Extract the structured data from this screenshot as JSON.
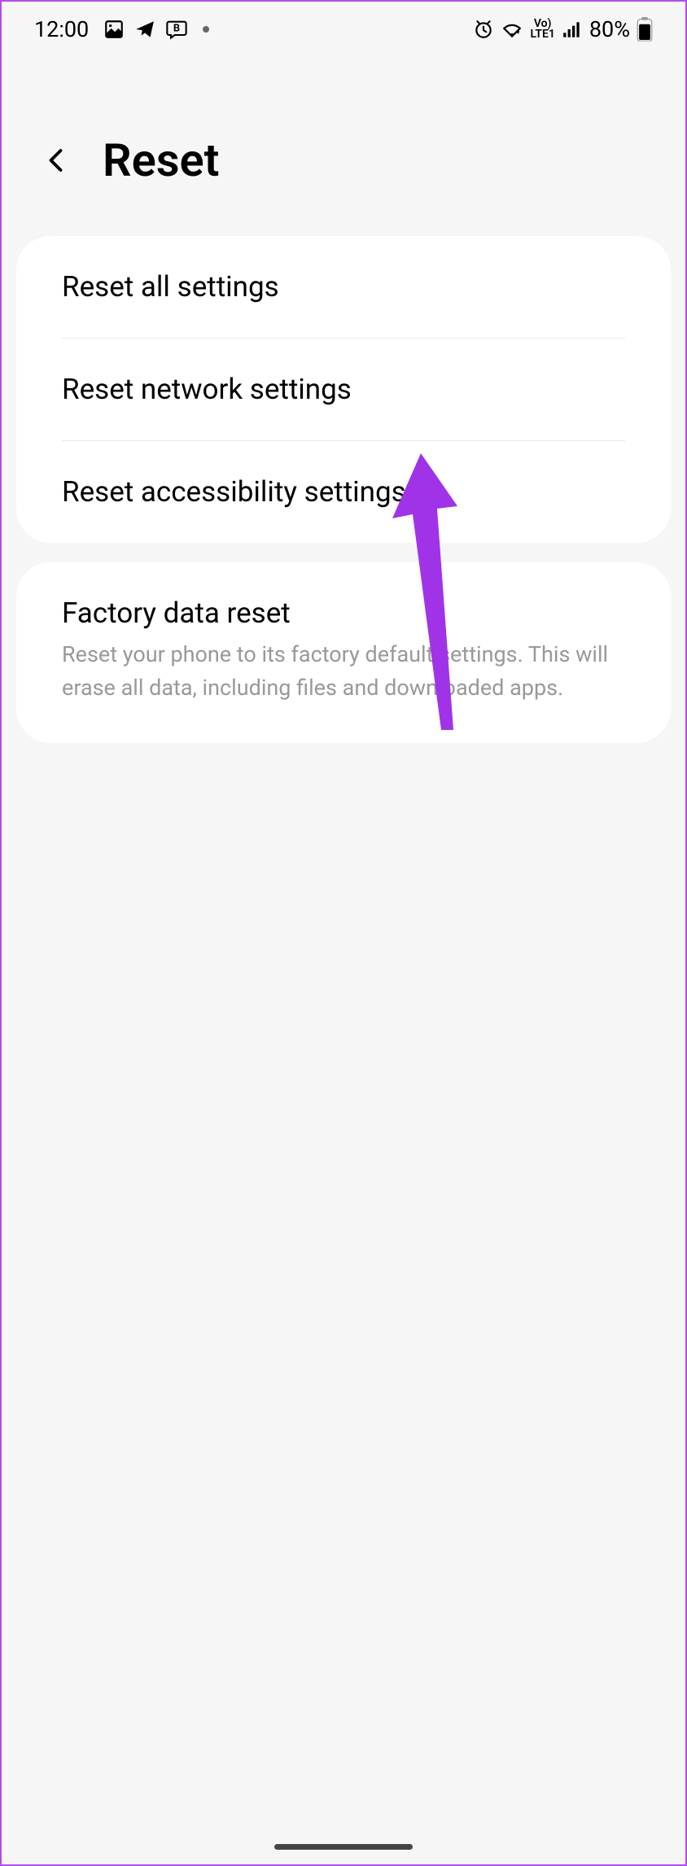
{
  "status_bar": {
    "time": "12:00",
    "battery_percent": "80%"
  },
  "header": {
    "title": "Reset"
  },
  "section1": {
    "items": [
      {
        "label": "Reset all settings"
      },
      {
        "label": "Reset network settings"
      },
      {
        "label": "Reset accessibility settings"
      }
    ]
  },
  "section2": {
    "title": "Factory data reset",
    "description": "Reset your phone to its factory default settings. This will erase all data, including files and downloaded apps."
  }
}
